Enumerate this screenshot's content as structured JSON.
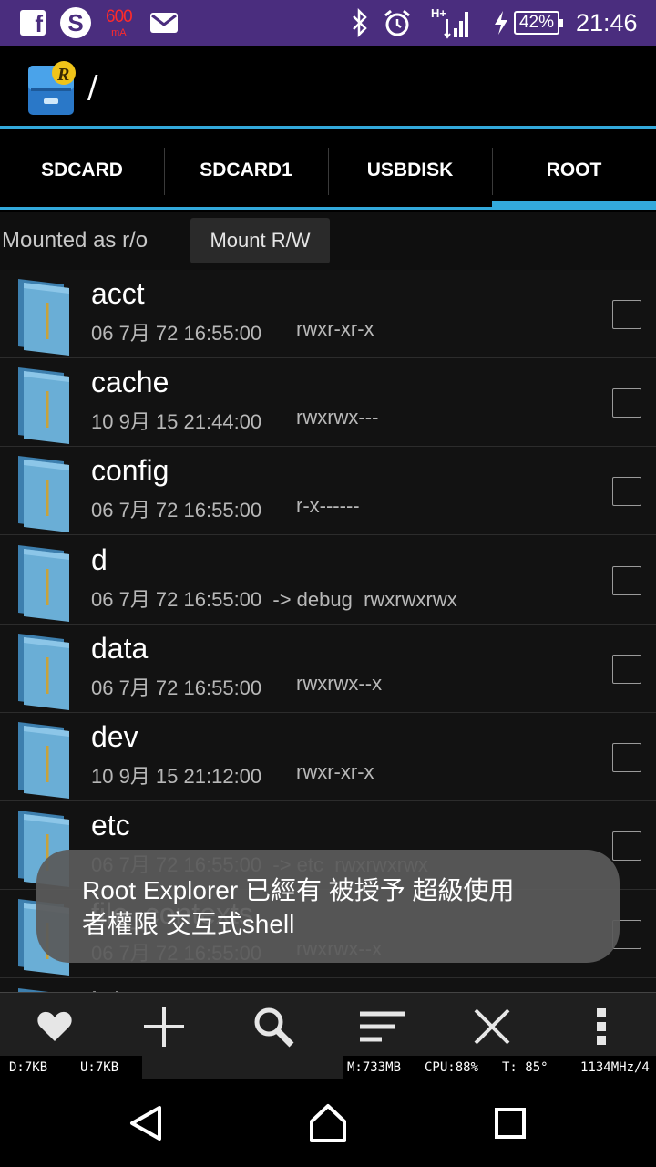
{
  "status_bar": {
    "fb_letter": "f",
    "skype_letter": "S",
    "current_value": "600",
    "current_unit": "mA",
    "network_label": "H+",
    "battery_percent": "42%",
    "time": "21:46",
    "icons": [
      "facebook-icon",
      "skype-icon",
      "mail-icon",
      "bluetooth-icon",
      "alarm-icon",
      "signal-icon",
      "charging-icon",
      "battery-icon"
    ]
  },
  "toolbar": {
    "app_icon_letter": "R",
    "path": "/"
  },
  "tabs": [
    {
      "label": "SDCARD",
      "active": false
    },
    {
      "label": "SDCARD1",
      "active": false
    },
    {
      "label": "USBDISK",
      "active": false
    },
    {
      "label": "ROOT",
      "active": true
    }
  ],
  "mount": {
    "status": "Mounted as r/o",
    "button_label": "Mount R/W"
  },
  "files": [
    {
      "name": "acct",
      "date": "06 7月 72 16:55:00",
      "link": "",
      "perm": "rwxr-xr-x"
    },
    {
      "name": "cache",
      "date": "10 9月 15 21:44:00",
      "link": "",
      "perm": "rwxrwx---"
    },
    {
      "name": "config",
      "date": "06 7月 72 16:55:00",
      "link": "",
      "perm": "r-x------"
    },
    {
      "name": "d",
      "date": "06 7月 72 16:55:00",
      "link": "-> debug",
      "perm": "rwxrwxrwx"
    },
    {
      "name": "data",
      "date": "06 7月 72 16:55:00",
      "link": "",
      "perm": "rwxrwx--x"
    },
    {
      "name": "dev",
      "date": "10 9月 15 21:12:00",
      "link": "",
      "perm": "rwxr-xr-x"
    },
    {
      "name": "etc",
      "date": "06 7月 72 16:55:00",
      "link": "-> etc",
      "perm": "rwxrwxrwx"
    },
    {
      "name": "file_contexts",
      "date": "06 7月 72 16:55:00",
      "link": "",
      "perm": "rwxrwx--x"
    },
    {
      "name": "init.rc",
      "date": "",
      "link": "",
      "perm": ""
    }
  ],
  "toast": {
    "line1": "Root Explorer 已經有 被授予 超級使用",
    "line2": "者權限 交互式shell"
  },
  "actions": [
    "favorite-icon",
    "add-icon",
    "search-icon",
    "sort-icon",
    "close-icon",
    "more-icon"
  ],
  "stats": {
    "download": "D:7KB",
    "upload": "U:7KB",
    "memory": "M:733MB",
    "cpu": "CPU:88%",
    "temp": "T: 85°",
    "freq": "1134MHz/4"
  },
  "colors": {
    "status_bar": "#4a2d7e",
    "accent": "#33a9dc",
    "folder": "#6aaed6",
    "list_bg": "#121212"
  }
}
